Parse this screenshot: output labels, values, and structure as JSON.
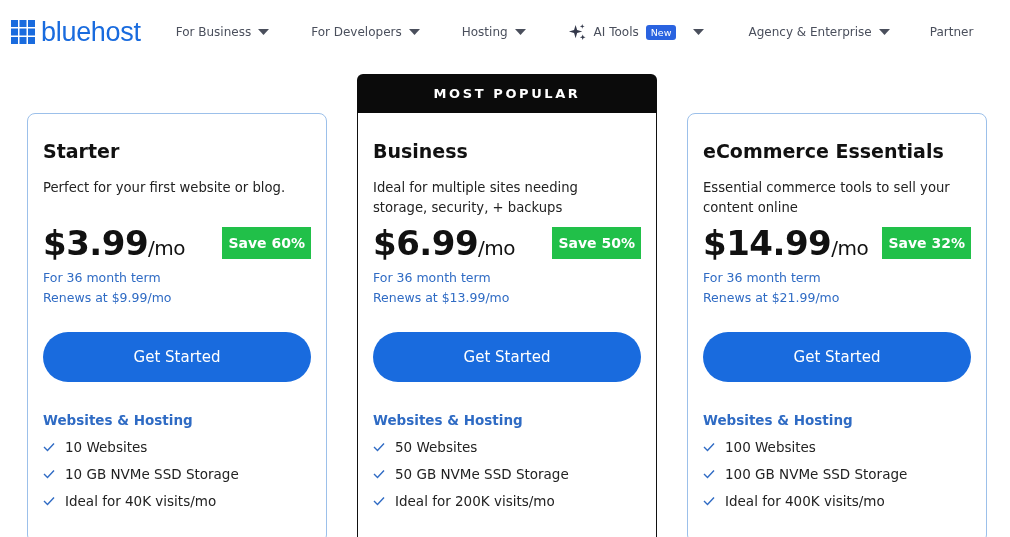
{
  "logo": {
    "text": "bluehost"
  },
  "nav": [
    {
      "label": "For Business",
      "kind": "menu"
    },
    {
      "label": "For Developers",
      "kind": "menu"
    },
    {
      "label": "Hosting",
      "kind": "menu"
    },
    {
      "label": "AI Tools",
      "kind": "ai",
      "badge": "New"
    },
    {
      "label": "Agency & Enterprise",
      "kind": "menu"
    },
    {
      "label": "Partner",
      "kind": "link"
    }
  ],
  "plans": [
    {
      "name": "Starter",
      "featured": false,
      "description": "Perfect for your first website or blog.",
      "price": "$3.99",
      "period": "/mo",
      "save": "Save 60%",
      "term": "For 36 month term",
      "renews": "Renews at $9.99/mo",
      "button": "Get Started",
      "section": "Websites & Hosting",
      "features": [
        "10 Websites",
        "10 GB NVMe SSD Storage",
        "Ideal for 40K visits/mo"
      ]
    },
    {
      "name": "Business",
      "featured": true,
      "banner": "MOST POPULAR",
      "description": "Ideal for multiple sites needing storage, security, + backups",
      "price": "$6.99",
      "period": "/mo",
      "save": "Save 50%",
      "term": "For 36 month term",
      "renews": "Renews at $13.99/mo",
      "button": "Get Started",
      "section": "Websites & Hosting",
      "features": [
        "50 Websites",
        "50 GB NVMe SSD Storage",
        "Ideal for 200K visits/mo"
      ]
    },
    {
      "name": "eCommerce Essentials",
      "featured": false,
      "description": "Essential commerce tools to sell your content online",
      "price": "$14.99",
      "period": "/mo",
      "save": "Save 32%",
      "term": "For 36 month term",
      "renews": "Renews at $21.99/mo",
      "button": "Get Started",
      "section": "Websites & Hosting",
      "features": [
        "100 Websites",
        "100 GB NVMe SSD Storage",
        "Ideal for 400K visits/mo"
      ]
    }
  ]
}
